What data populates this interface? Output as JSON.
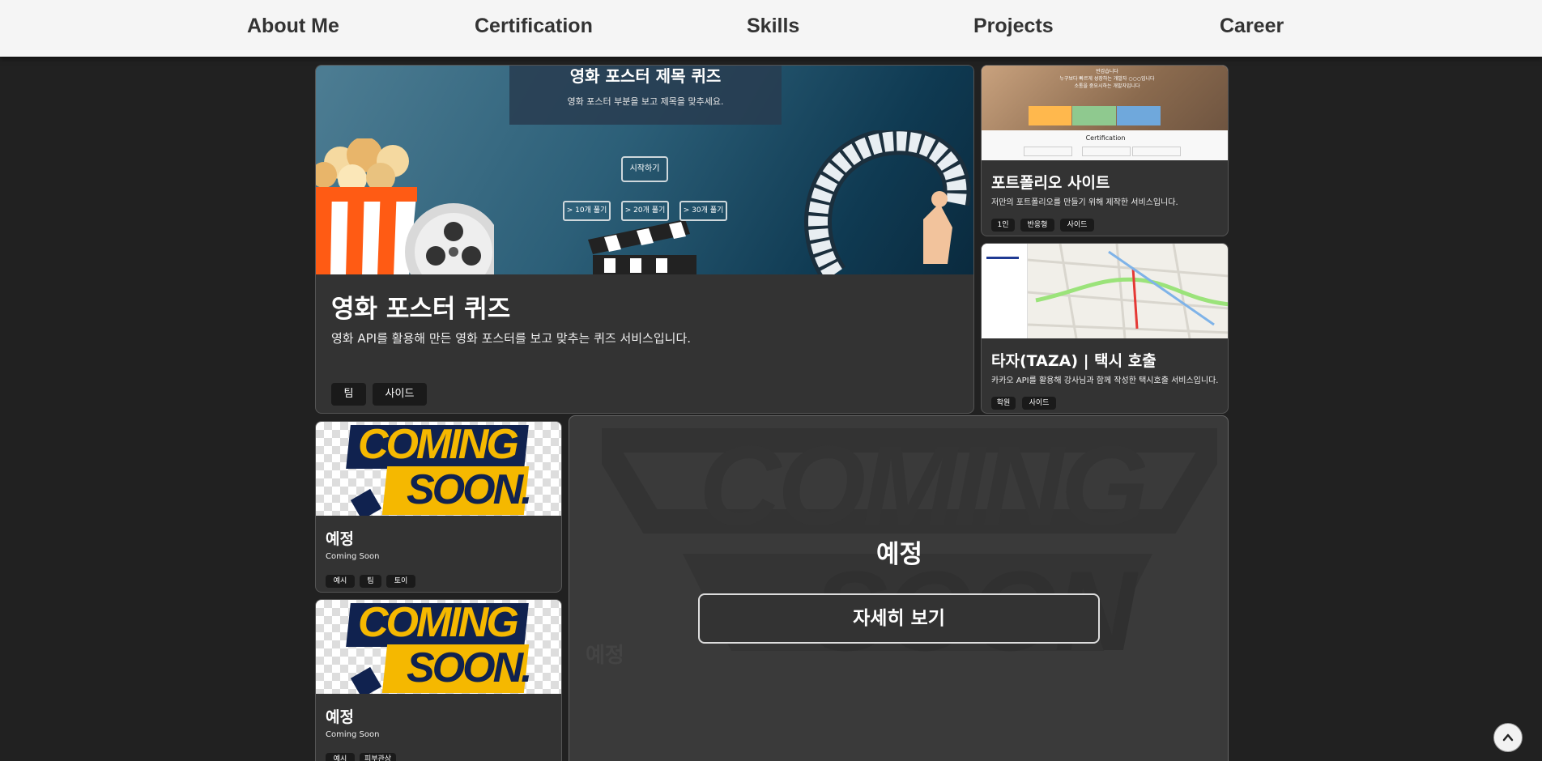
{
  "nav": {
    "items": [
      "About Me",
      "Certification",
      "Skills",
      "Projects",
      "Career"
    ]
  },
  "featured": {
    "image": {
      "quiz_title": "영화 포스터 제목 퀴즈",
      "quiz_subtitle": "영화 포스터 부분을 보고 제목을 맞추세요.",
      "start_label": "시작하기",
      "options": [
        "> 10개 풀기",
        "> 20개 풀기",
        "> 30개 풀기"
      ]
    },
    "title": "영화 포스터 퀴즈",
    "description": "영화 API를 활용해 만든 영화 포스터를 보고 맞추는 퀴즈 서비스입니다.",
    "tags": [
      "팀",
      "사이드"
    ]
  },
  "portfolio": {
    "image": {
      "heading_lines": [
        "반갑습니다",
        "누구보다 빠르게 성장하는 개발자 ○○○입니다",
        "소통을 중요시하는 개발자입니다"
      ],
      "section": "Certification"
    },
    "title": "포트폴리오 사이트",
    "description": "저만의 포트폴리오를 만들기 위해 제작한 서비스입니다.",
    "tags": [
      "1인",
      "반응형",
      "사이드"
    ]
  },
  "taza": {
    "title": "타자(TAZA) | 택시 호출",
    "description": "카카오 API를 활용해 강사님과 함께 작성한 택시호출 서비스입니다.",
    "tags": [
      "학원",
      "사이드"
    ]
  },
  "upcoming_1": {
    "image_text": [
      "COMING",
      "SOON."
    ],
    "title": "예정",
    "description": "Coming Soon",
    "tags": [
      "예시",
      "팀",
      "토이"
    ]
  },
  "upcoming_2": {
    "image_text": [
      "COMING",
      "SOON."
    ],
    "title": "예정",
    "description": "Coming Soon",
    "tags": [
      "예시",
      "피부관상"
    ]
  },
  "detail": {
    "bg_text": [
      "COMING",
      "SOON"
    ],
    "title": "예정",
    "button_label": "자세히 보기",
    "ghost_label": "예정"
  },
  "colors": {
    "background": "#212121",
    "card": "#333333",
    "nav": "#f5f5f5",
    "tag": "#1a1a1a",
    "accent_yellow": "#f5b800",
    "accent_navy": "#10224f"
  },
  "icons": {
    "scroll_top": "chevron-up-icon"
  }
}
